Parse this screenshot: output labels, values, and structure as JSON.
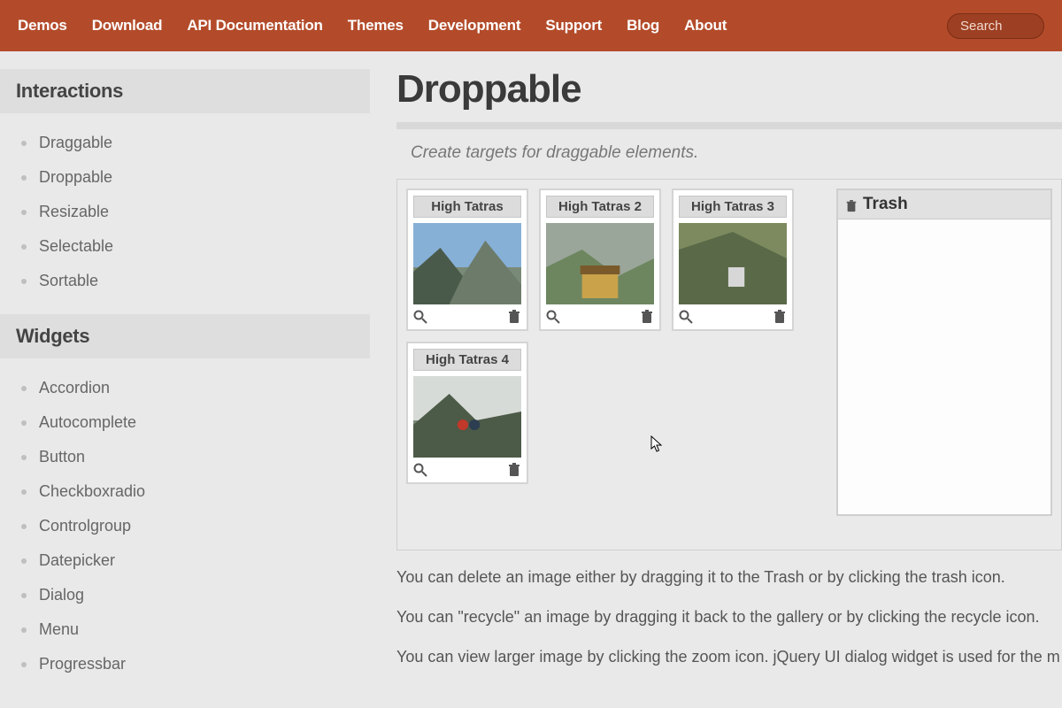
{
  "nav": {
    "items": [
      "Demos",
      "Download",
      "API Documentation",
      "Themes",
      "Development",
      "Support",
      "Blog",
      "About"
    ],
    "search_placeholder": "Search"
  },
  "sidebar": {
    "sections": [
      {
        "title": "Interactions",
        "items": [
          "Draggable",
          "Droppable",
          "Resizable",
          "Selectable",
          "Sortable"
        ]
      },
      {
        "title": "Widgets",
        "items": [
          "Accordion",
          "Autocomplete",
          "Button",
          "Checkboxradio",
          "Controlgroup",
          "Datepicker",
          "Dialog",
          "Menu",
          "Progressbar"
        ]
      }
    ]
  },
  "page": {
    "title": "Droppable",
    "tagline": "Create targets for draggable elements."
  },
  "gallery": {
    "cards": [
      {
        "title": "High Tatras"
      },
      {
        "title": "High Tatras 2"
      },
      {
        "title": "High Tatras 3"
      },
      {
        "title": "High Tatras 4"
      }
    ]
  },
  "trash": {
    "label": "Trash"
  },
  "description": {
    "p1": "You can delete an image either by dragging it to the Trash or by clicking the trash icon.",
    "p2": "You can \"recycle\" an image by dragging it back to the gallery or by clicking the recycle icon.",
    "p3": "You can view larger image by clicking the zoom icon. jQuery UI dialog widget is used for the m"
  }
}
